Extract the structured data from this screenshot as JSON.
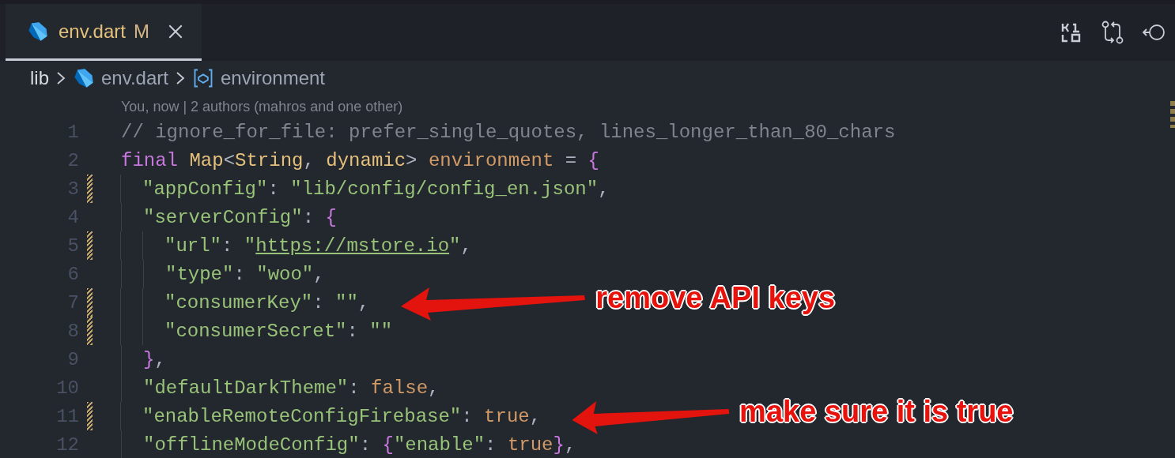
{
  "tabs": [
    {
      "label": "env.dart",
      "badge": "M",
      "selected": true
    }
  ],
  "breadcrumb": [
    {
      "label": "lib",
      "kind": "folder"
    },
    {
      "label": "env.dart",
      "kind": "file"
    },
    {
      "label": "environment",
      "kind": "symbol"
    }
  ],
  "blame": "You, now | 2 authors (mahros and one other)",
  "lines": [
    {
      "number": "1",
      "modified": false,
      "tokens": [
        {
          "text": "// ignore_for_file: prefer_single_quotes, lines_longer_than_80_chars",
          "kind": "comment"
        }
      ]
    },
    {
      "number": "2",
      "modified": false,
      "tokens": [
        {
          "text": "final ",
          "kind": "keyword"
        },
        {
          "text": "Map",
          "kind": "type"
        },
        {
          "text": "<",
          "kind": "punct"
        },
        {
          "text": "String",
          "kind": "type"
        },
        {
          "text": ", ",
          "kind": "punct"
        },
        {
          "text": "dynamic",
          "kind": "type"
        },
        {
          "text": "> ",
          "kind": "punct"
        },
        {
          "text": "environment",
          "kind": "var"
        },
        {
          "text": " = ",
          "kind": "punct"
        },
        {
          "text": "{",
          "kind": "brace"
        }
      ],
      "children": [
        {
          "number": "3",
          "modified": true,
          "tokens": [
            {
              "text": "\"appConfig\"",
              "kind": "string"
            },
            {
              "text": ": ",
              "kind": "punct"
            },
            {
              "text": "\"lib/config/config_en.json\"",
              "kind": "string"
            },
            {
              "text": ",",
              "kind": "punct"
            }
          ]
        },
        {
          "number": "4",
          "modified": false,
          "tokens": [
            {
              "text": "\"serverConfig\"",
              "kind": "string"
            },
            {
              "text": ": ",
              "kind": "punct"
            },
            {
              "text": "{",
              "kind": "brace"
            }
          ],
          "children": [
            {
              "number": "5",
              "modified": true,
              "tokens": [
                {
                  "text": "\"url\"",
                  "kind": "string"
                },
                {
                  "text": ": ",
                  "kind": "punct"
                },
                {
                  "text": "\"",
                  "kind": "string"
                },
                {
                  "text": "https://mstore.io",
                  "kind": "link"
                },
                {
                  "text": "\"",
                  "kind": "string"
                },
                {
                  "text": ",",
                  "kind": "punct"
                }
              ]
            },
            {
              "number": "6",
              "modified": false,
              "tokens": [
                {
                  "text": "\"type\"",
                  "kind": "string"
                },
                {
                  "text": ": ",
                  "kind": "punct"
                },
                {
                  "text": "\"woo\"",
                  "kind": "string"
                },
                {
                  "text": ",",
                  "kind": "punct"
                }
              ]
            },
            {
              "number": "7",
              "modified": true,
              "tokens": [
                {
                  "text": "\"consumerKey\"",
                  "kind": "string"
                },
                {
                  "text": ": ",
                  "kind": "punct"
                },
                {
                  "text": "\"\"",
                  "kind": "string"
                },
                {
                  "text": ",",
                  "kind": "punct"
                }
              ],
              "note": "remove API keys"
            },
            {
              "number": "8",
              "modified": true,
              "tokens": [
                {
                  "text": "\"consumerSecret\"",
                  "kind": "string"
                },
                {
                  "text": ": ",
                  "kind": "punct"
                },
                {
                  "text": "\"\"",
                  "kind": "string"
                }
              ]
            }
          ]
        },
        {
          "number": "9",
          "modified": false,
          "tokens": [
            {
              "text": "}",
              "kind": "brace"
            },
            {
              "text": ",",
              "kind": "punct"
            }
          ]
        },
        {
          "number": "10",
          "modified": false,
          "tokens": [
            {
              "text": "\"defaultDarkTheme\"",
              "kind": "string"
            },
            {
              "text": ": ",
              "kind": "punct"
            },
            {
              "text": "false",
              "kind": "bool"
            },
            {
              "text": ",",
              "kind": "punct"
            }
          ]
        },
        {
          "number": "11",
          "modified": true,
          "tokens": [
            {
              "text": "\"enableRemoteConfigFirebase\"",
              "kind": "string"
            },
            {
              "text": ": ",
              "kind": "punct"
            },
            {
              "text": "true",
              "kind": "bool"
            },
            {
              "text": ",",
              "kind": "punct"
            }
          ],
          "note": "make sure it is true"
        },
        {
          "number": "12",
          "modified": false,
          "tokens": [
            {
              "text": "\"offlineModeConfig\"",
              "kind": "string"
            },
            {
              "text": ": ",
              "kind": "punct"
            },
            {
              "text": "{",
              "kind": "brace"
            },
            {
              "text": "\"enable\"",
              "kind": "string"
            },
            {
              "text": ": ",
              "kind": "punct"
            },
            {
              "text": "true",
              "kind": "bool"
            },
            {
              "text": "}",
              "kind": "brace"
            },
            {
              "text": ",",
              "kind": "punct"
            }
          ]
        }
      ]
    }
  ]
}
